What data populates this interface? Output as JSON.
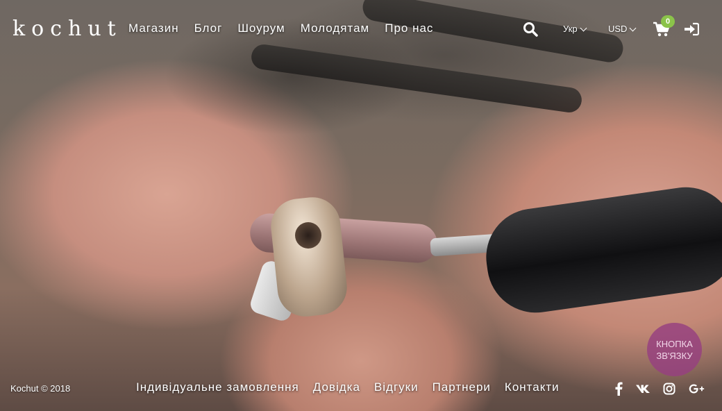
{
  "header": {
    "logo_text": "kochut",
    "nav": [
      "Магазин",
      "Блог",
      "Шоурум",
      "Молодятам",
      "Про нас"
    ],
    "language": "Укр",
    "currency": "USD",
    "cart_count": "0"
  },
  "contact_button": {
    "line1": "КНОПКА",
    "line2": "ЗВ'ЯЗКУ"
  },
  "footer": {
    "copyright": "Kochut © 2018",
    "nav": [
      "Індивідуальне замовлення",
      "Довідка",
      "Відгуки",
      "Партнери",
      "Контакти"
    ],
    "social": [
      "facebook-icon",
      "vk-icon",
      "instagram-icon",
      "google-plus-icon"
    ]
  },
  "colors": {
    "accent_badge": "#8bc34a",
    "contact_button": "#964080"
  }
}
